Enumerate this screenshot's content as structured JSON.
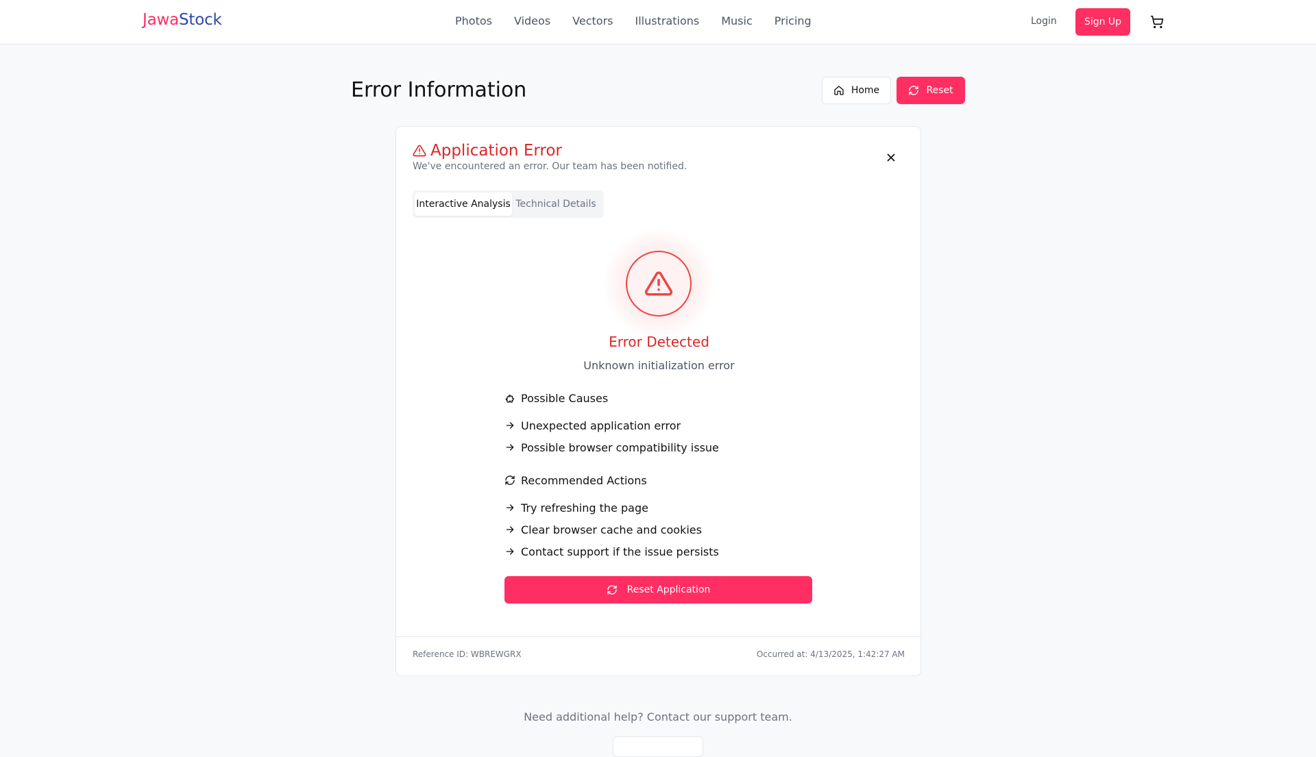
{
  "header": {
    "logo_part1": "Jawa",
    "logo_part2": "Stock",
    "nav": [
      "Photos",
      "Videos",
      "Vectors",
      "Illustrations",
      "Music",
      "Pricing"
    ],
    "login": "Login",
    "signup": "Sign Up",
    "cart_icon": "shopping-cart-icon"
  },
  "page": {
    "title": "Error Information",
    "home_button": "Home",
    "reset_button": "Reset"
  },
  "card": {
    "title": "Application Error",
    "subtitle": "We've encountered an error. Our team has been notified.",
    "tabs": [
      "Interactive Analysis",
      "Technical Details"
    ],
    "active_tab": "Interactive Analysis",
    "error_title": "Error Detected",
    "error_message": "Unknown initialization error",
    "causes_heading": "Possible Causes",
    "causes": [
      "Unexpected application error",
      "Possible browser compatibility issue"
    ],
    "actions_heading": "Recommended Actions",
    "actions": [
      "Try refreshing the page",
      "Clear browser cache and cookies",
      "Contact support if the issue persists"
    ],
    "reset_app_button": "Reset Application",
    "reference": "Reference ID: WBREWGRX",
    "occurred": "Occurred at: 4/13/2025, 1:42:27 AM"
  },
  "footer": {
    "help_text": "Need additional help? Contact our support team."
  },
  "colors": {
    "brand_pink": "#ff2e63",
    "brand_blue": "#2b4aa8",
    "error_red": "#dc2626"
  }
}
